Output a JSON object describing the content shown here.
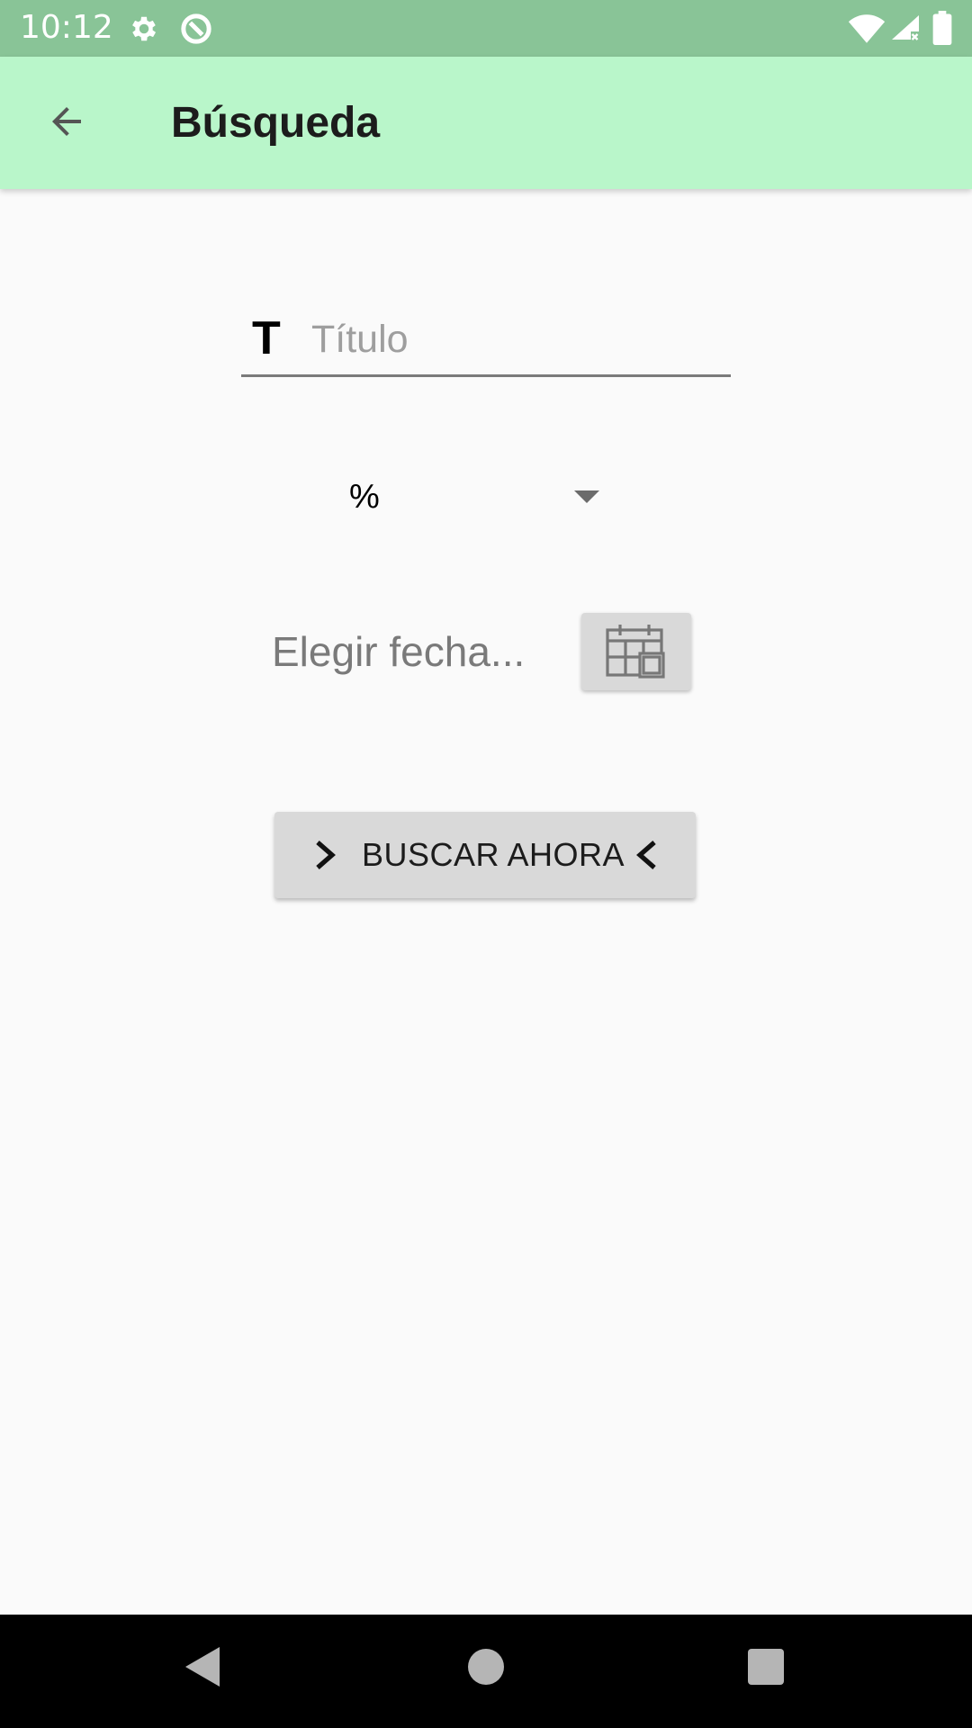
{
  "status_bar": {
    "time": "10:12",
    "icons": [
      "gear-icon",
      "data-saver-icon",
      "wifi-icon",
      "signal-icon",
      "battery-icon"
    ]
  },
  "app_bar": {
    "title": "Búsqueda",
    "back_icon": "arrow-back-icon",
    "background": "#b9f6ca"
  },
  "form": {
    "title_field": {
      "icon_text": "T",
      "placeholder": "Título",
      "value": ""
    },
    "spinner": {
      "selected": "%"
    },
    "date": {
      "label": "Elegir fecha...",
      "button_icon": "calendar-icon"
    },
    "search_button": {
      "label": "BUSCAR AHORA",
      "left_icon": "chevron-right-icon",
      "right_icon": "chevron-left-icon"
    }
  },
  "nav_bar": {
    "items": [
      "back-triangle-icon",
      "home-circle-icon",
      "recents-square-icon"
    ]
  },
  "colors": {
    "status_bar": "#89c497",
    "app_bar": "#b9f6ca",
    "background": "#fafafa",
    "button": "#d9d9d9"
  }
}
